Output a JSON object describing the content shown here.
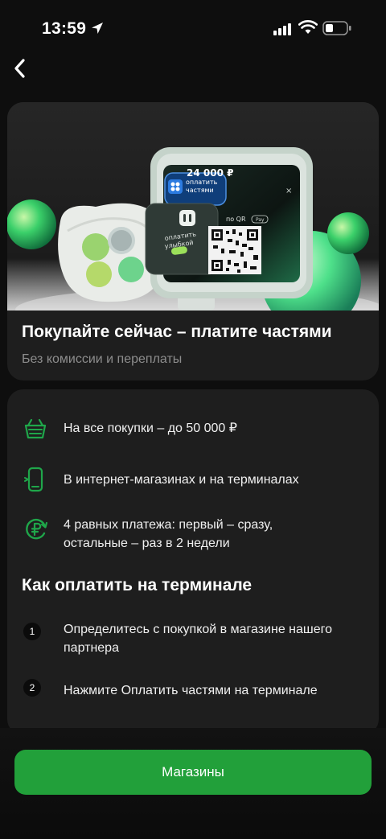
{
  "status_bar": {
    "time": "13:59"
  },
  "promo": {
    "title": "Покупайте сейчас – платите частями",
    "subtitle": "Без комиссии и переплаты",
    "terminal": {
      "amount": "24 000 ₽",
      "pay_parts_label_line1": "оплатить",
      "pay_parts_label_line2": "частями",
      "smile_label_line1": "оплатить",
      "smile_label_line2": "улыбкой",
      "qr_label": "по QR",
      "pay_badge": "Pay"
    }
  },
  "features": [
    {
      "icon": "basket-icon",
      "text": "На все покупки – до 50 000 ₽"
    },
    {
      "icon": "phone-icon",
      "text": "В интернет-магазинах и на терминалах"
    },
    {
      "icon": "ruble-cycle-icon",
      "line1": "4 равных платежа: первый – сразу,",
      "line2": "остальные – раз в 2 недели"
    }
  ],
  "how_to": {
    "title": "Как оплатить на терминале",
    "steps": [
      {
        "num": "1",
        "line1": "Определитесь с покупкой в магазине нашего",
        "line2": "партнера"
      },
      {
        "num": "2",
        "line1": "Нажмите Оплатить частями на терминале"
      }
    ]
  },
  "actions": {
    "shops_label": "Магазины"
  },
  "colors": {
    "accent": "#22a03a",
    "card": "#1e1e1e",
    "background": "#0e0e0e",
    "icon_green": "#1fa64a"
  }
}
